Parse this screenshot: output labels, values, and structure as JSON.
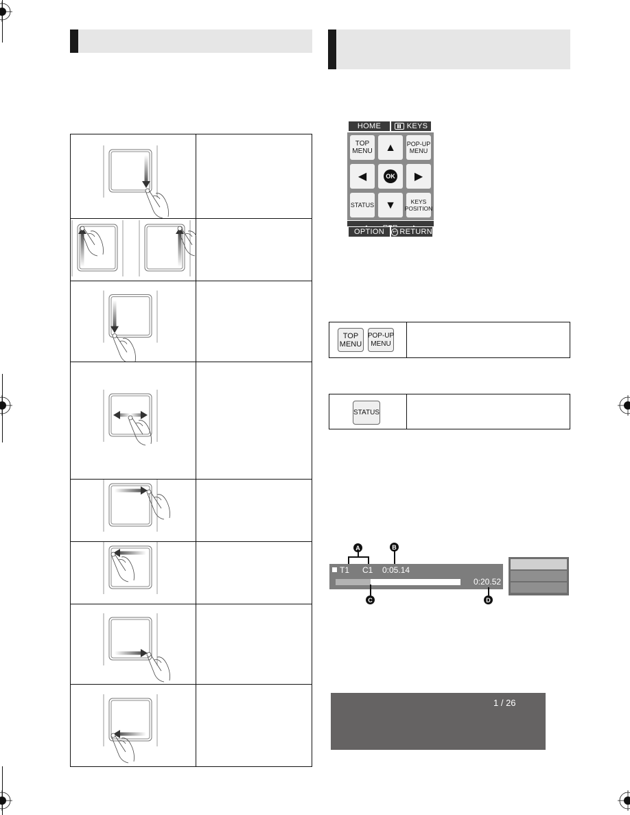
{
  "page": {
    "left_section": {
      "header_title": "",
      "gesture_table": {
        "rows": [
          {
            "gesture": "swipe-down-right-edge",
            "description": ""
          },
          {
            "gesture": "swipe-up-left-and-right-edges",
            "description": ""
          },
          {
            "gesture": "swipe-down-left-edge",
            "description": ""
          },
          {
            "gesture": "swipe-left-right-center",
            "description": ""
          },
          {
            "gesture": "swipe-right-top-edge",
            "description": ""
          },
          {
            "gesture": "swipe-left-top-edge",
            "description": ""
          },
          {
            "gesture": "swipe-right-bottom-edge",
            "description": ""
          },
          {
            "gesture": "swipe-left-bottom-edge",
            "description": ""
          }
        ]
      }
    },
    "right_section": {
      "header_title": "",
      "keypad": {
        "top_left": "HOME",
        "top_right": "KEYS",
        "keys": {
          "top_menu": "TOP\nMENU",
          "up": "▲",
          "popup_menu": "POP-UP\nMENU",
          "left": "◀",
          "ok": "OK",
          "right": "▶",
          "status": "STATUS",
          "down": "▼",
          "keys_position": "KEYS\nPOSITION"
        },
        "bottom_left": "OPTION",
        "bottom_right": "RETURN"
      },
      "menu_table": {
        "buttons": [
          "TOP\nMENU",
          "POP-UP\nMENU"
        ],
        "description": ""
      },
      "status_table": {
        "buttons": [
          "STATUS"
        ],
        "description": ""
      },
      "status_display": {
        "title": "T1",
        "chapter": "C1",
        "elapsed": "0:05.14",
        "total": "0:20.52",
        "progress": 0.28,
        "callouts": [
          "A",
          "B",
          "C",
          "D"
        ]
      },
      "info_box": {
        "page_indicator": "1 / 26"
      }
    }
  }
}
